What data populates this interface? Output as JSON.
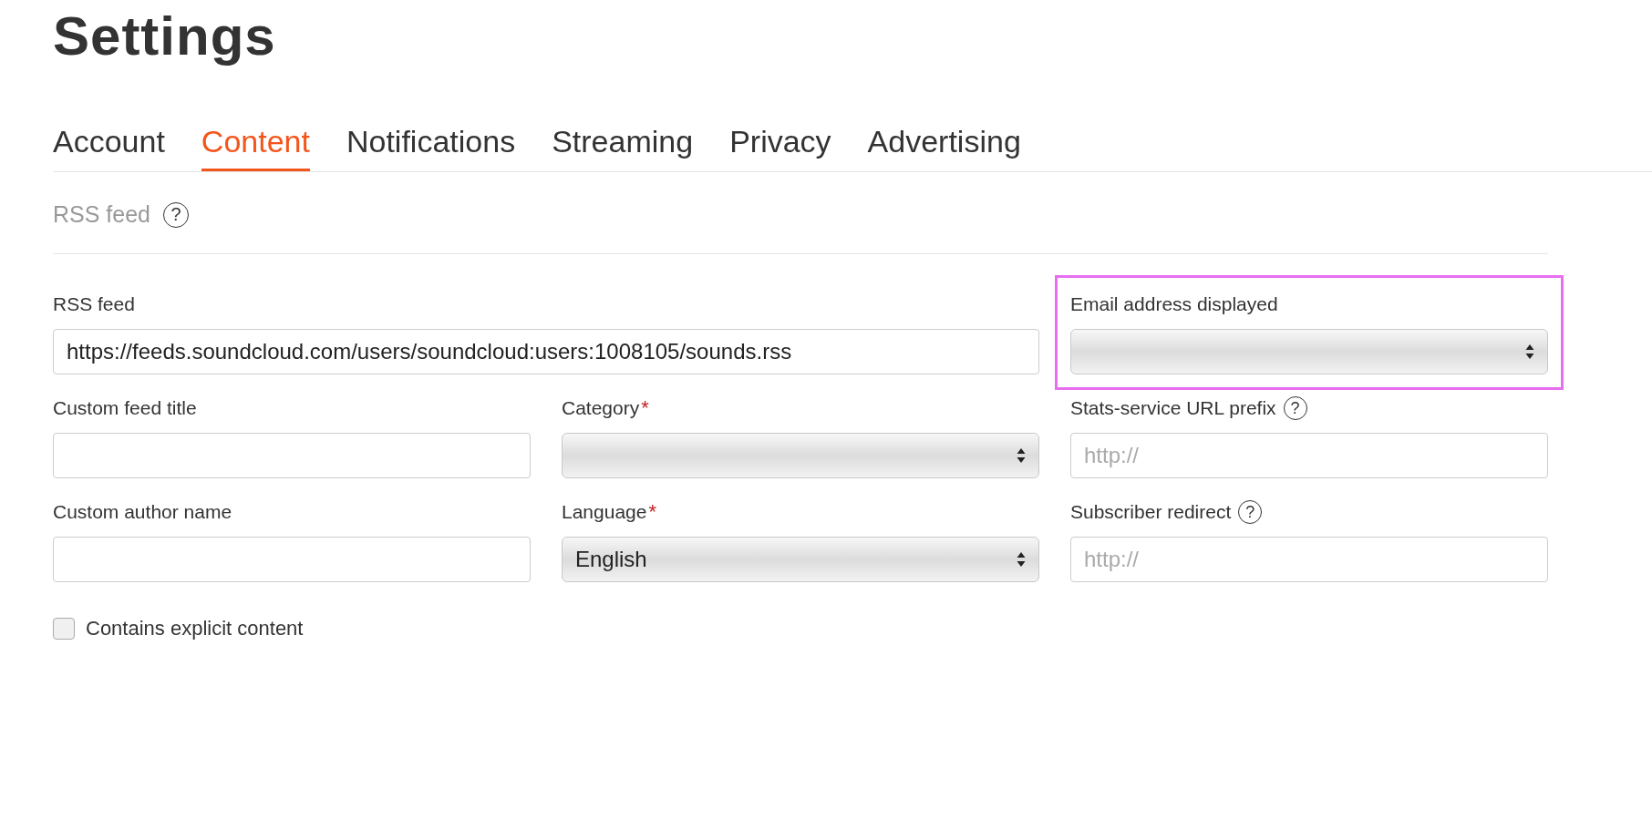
{
  "title": "Settings",
  "tabs": [
    {
      "label": "Account",
      "selected": false
    },
    {
      "label": "Content",
      "selected": true
    },
    {
      "label": "Notifications",
      "selected": false
    },
    {
      "label": "Streaming",
      "selected": false
    },
    {
      "label": "Privacy",
      "selected": false
    },
    {
      "label": "Advertising",
      "selected": false
    }
  ],
  "section": {
    "title": "RSS feed",
    "help": "?"
  },
  "rows": [
    [
      {
        "kind": "text",
        "label": "RSS feed",
        "value": "https://feeds.soundcloud.com/users/soundcloud:users:1008105/sounds.rss"
      },
      {
        "kind": "select",
        "label": "Email address displayed",
        "highlighted": true
      }
    ],
    [
      {
        "kind": "text",
        "label": "Custom feed title"
      },
      {
        "kind": "select",
        "label": "Category",
        "required_mark": "*"
      },
      {
        "kind": "text",
        "label": "Stats-service URL prefix",
        "help": "?",
        "placeholder": "http://"
      }
    ],
    [
      {
        "kind": "text",
        "label": "Custom author name"
      },
      {
        "kind": "select",
        "label": "Language",
        "required_mark": "*",
        "value": "English"
      },
      {
        "kind": "text",
        "label": "Subscriber redirect",
        "help": "?",
        "placeholder": "http://"
      }
    ]
  ],
  "checkbox": {
    "label": "Contains explicit content",
    "checked": false
  }
}
